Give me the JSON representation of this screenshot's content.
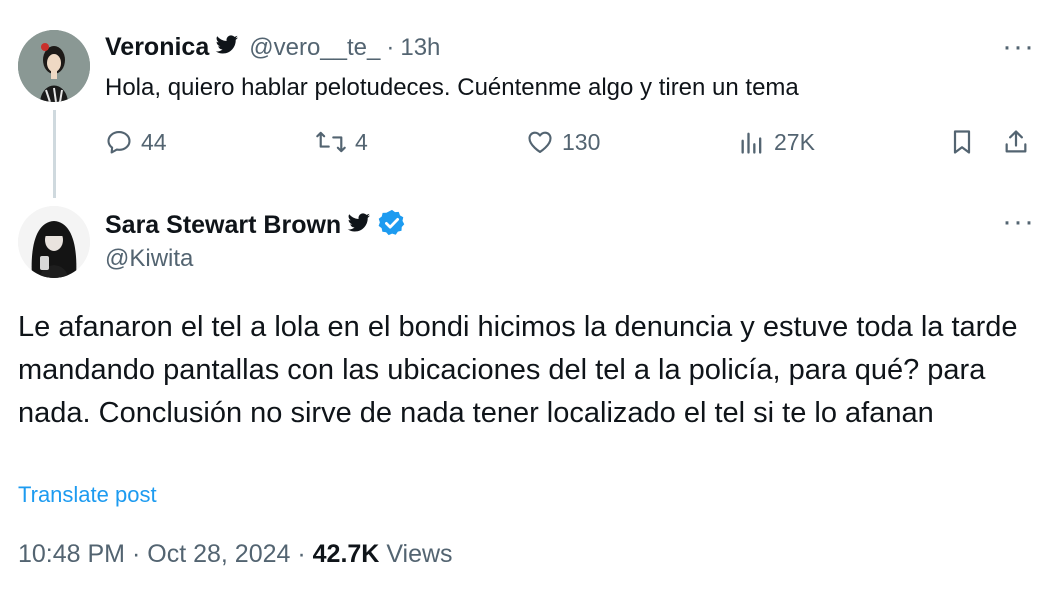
{
  "reply_to": {
    "name": "Veronica",
    "handle": "@vero__te_",
    "separator": "·",
    "time": "13h",
    "text": "Hola, quiero hablar pelotudeces. Cuéntenme algo y tiren un tema",
    "replies": "44",
    "reposts": "4",
    "likes": "130",
    "views": "27K"
  },
  "post": {
    "name": "Sara Stewart Brown",
    "handle": "@Kiwita",
    "text": "Le afanaron el tel a lola en el bondi hicimos la denuncia y estuve toda la tarde mandando pantallas con las ubicaciones del tel a la policía, para qué? para nada. Conclusión no sirve de nada tener localizado el tel si te lo afanan",
    "translate_label": "Translate post",
    "time": "10:48 PM",
    "separator": "·",
    "date": "Oct 28, 2024",
    "views_count": "42.7K",
    "views_label": "Views"
  },
  "more_label": "···",
  "colors": {
    "text": "#0f1419",
    "secondary": "#536471",
    "link": "#1d9bf0",
    "verified": "#1d9bf0",
    "thread_line": "#cfd9de"
  },
  "icons": [
    "twitter-bird-icon",
    "verified-badge-icon",
    "reply-icon",
    "repost-icon",
    "like-icon",
    "views-icon",
    "bookmark-icon",
    "share-icon",
    "more-icon"
  ]
}
